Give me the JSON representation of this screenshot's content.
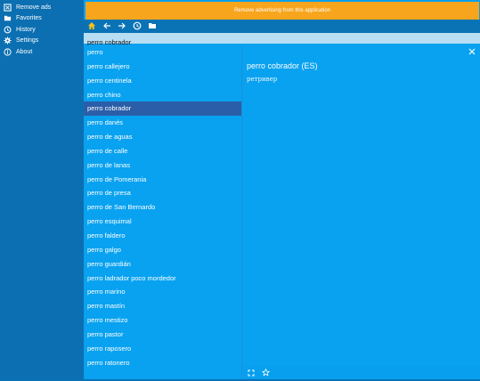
{
  "sidebar": {
    "items": [
      {
        "label": "Remove ads",
        "icon": "remove-ads-icon"
      },
      {
        "label": "Favorites",
        "icon": "folder-icon"
      },
      {
        "label": "History",
        "icon": "history-icon"
      },
      {
        "label": "Settings",
        "icon": "gear-icon"
      },
      {
        "label": "About",
        "icon": "info-icon"
      }
    ]
  },
  "banner": {
    "text": "Remove advertising from this application"
  },
  "toolbar": {
    "icons": [
      "home-icon",
      "back-arrow-icon",
      "forward-arrow-icon",
      "history-icon",
      "folder-icon"
    ]
  },
  "search": {
    "value": "perro cobrador"
  },
  "list": {
    "items": [
      "perro",
      "perro callejero",
      "perro centinela",
      "perro chino",
      "perro cobrador",
      "perro danés",
      "perro de aguas",
      "perro de calle",
      "perro de lanas",
      "perro de Pomerania",
      "perro de presa",
      "perro de San Bernardo",
      "perro esquimal",
      "perro faldero",
      "perro galgo",
      "perro guardián",
      "perro ladrador poco mordedor",
      "perro marino",
      "perro mastín",
      "perro mestizo",
      "perro pastor",
      "perro raposero",
      "perro ratonero"
    ],
    "selected": "perro cobrador"
  },
  "detail": {
    "title": "perro cobrador (ES)",
    "translation": "ретривер"
  },
  "colors": {
    "banner": "#f7a51c",
    "selected": "#2b5ea8",
    "main": "#08a0ee",
    "sidebar": "#0c6fb1"
  }
}
